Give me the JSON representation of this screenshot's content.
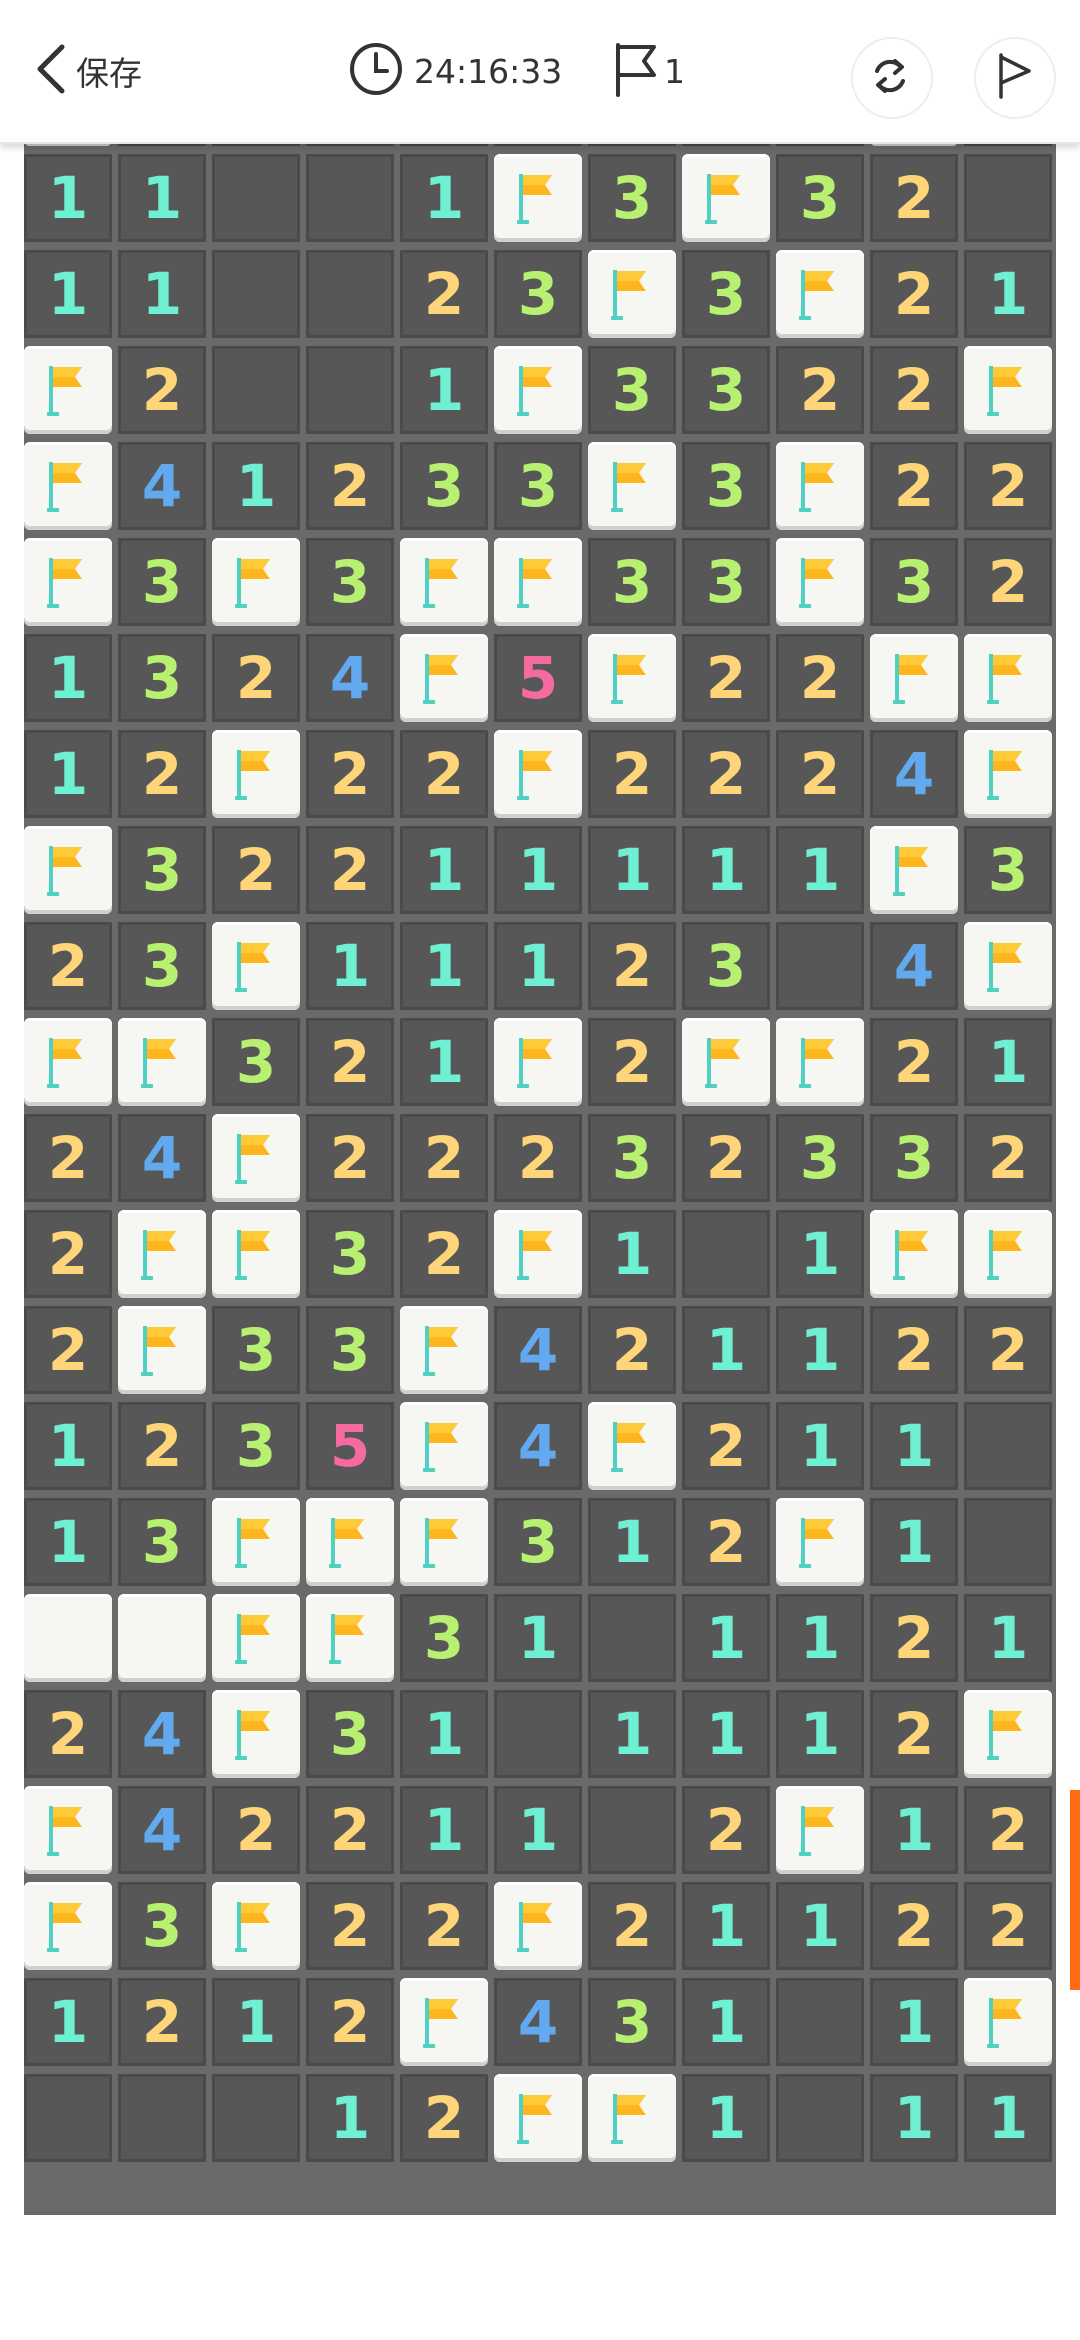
{
  "header": {
    "back_label": "保存",
    "timer": "24:16:33",
    "flag_count": "1"
  },
  "colors": {
    "1": "#6ff0d2",
    "2": "#ffd57a",
    "3": "#b8f071",
    "4": "#63a9f0",
    "5": "#f56b9f",
    "accent": "#ff6a13"
  },
  "board": {
    "columns": 11,
    "rows": [
      "F21_11222F1_",
      "11__1F3F32_",
      "11__23F3F21",
      "F2__1F3322F",
      "F41233F3F221",
      "F3F3FF33F32",
      "1324F5F22FF",
      "12F22F2224F",
      "F32211111F32",
      "23F11123 4F1",
      "FF321F2FF21",
      "24F22232332",
      "2FF32F1_1FF",
      "2F33F421122",
      "1235F4F211_",
      "13FFF312F1_",
      "BBFF31_1121",
      "24F31_1112F",
      "F42211 2F12F",
      "F3F22F21122",
      "1212F431_1F",
      "___12FF1_11"
    ]
  }
}
